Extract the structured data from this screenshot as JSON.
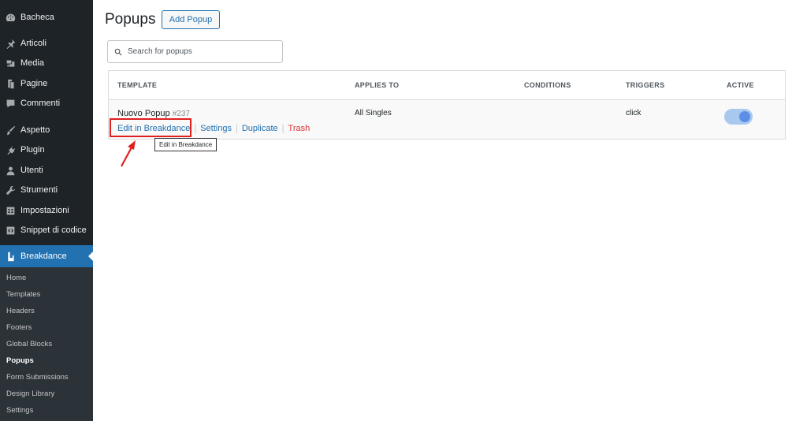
{
  "sidebar": {
    "items": [
      {
        "label": "Bacheca",
        "icon": "dashboard-icon"
      },
      {
        "label": "Articoli",
        "icon": "pin-icon"
      },
      {
        "label": "Media",
        "icon": "media-icon"
      },
      {
        "label": "Pagine",
        "icon": "page-icon"
      },
      {
        "label": "Commenti",
        "icon": "comment-icon"
      },
      {
        "label": "Aspetto",
        "icon": "brush-icon"
      },
      {
        "label": "Plugin",
        "icon": "plugin-icon"
      },
      {
        "label": "Utenti",
        "icon": "user-icon"
      },
      {
        "label": "Strumenti",
        "icon": "wrench-icon"
      },
      {
        "label": "Impostazioni",
        "icon": "settings-icon"
      },
      {
        "label": "Snippet di codice",
        "icon": "code-icon"
      },
      {
        "label": "Breakdance",
        "icon": "breakdance-icon"
      }
    ],
    "submenu": [
      "Home",
      "Templates",
      "Headers",
      "Footers",
      "Global Blocks",
      "Popups",
      "Form Submissions",
      "Design Library",
      "Settings"
    ],
    "active_submenu": "Popups"
  },
  "header": {
    "title": "Popups",
    "add_button": "Add Popup"
  },
  "search": {
    "placeholder": "Search for popups"
  },
  "table": {
    "columns": [
      "TEMPLATE",
      "APPLIES TO",
      "CONDITIONS",
      "TRIGGERS",
      "ACTIVE"
    ],
    "rows": [
      {
        "name": "Nuovo Popup",
        "id": "#237",
        "applies_to": "All Singles",
        "conditions": "",
        "triggers": "click",
        "active": true,
        "actions": {
          "edit": "Edit in Breakdance",
          "settings": "Settings",
          "duplicate": "Duplicate",
          "trash": "Trash"
        }
      }
    ]
  },
  "tooltip": "Edit in Breakdance",
  "colors": {
    "accent": "#2271b1",
    "sidebar": "#1d2327",
    "danger": "#d63638",
    "highlight": "#e02020"
  }
}
